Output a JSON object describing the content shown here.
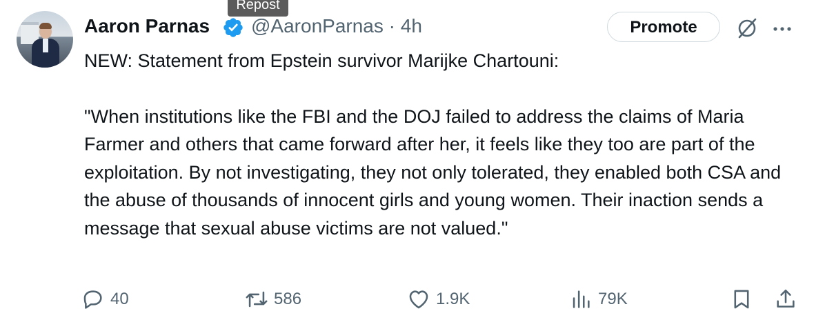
{
  "tooltip": {
    "text": "Repost"
  },
  "author": {
    "name": "Aaron Parnas",
    "handle": "@AaronParnas",
    "time": "4h",
    "verified_color": "#1d9bf0"
  },
  "header": {
    "promote_label": "Promote",
    "icons": [
      "grok-icon",
      "more-options-icon"
    ]
  },
  "post": {
    "intro": "NEW: Statement from Epstein survivor Marijke Chartouni:",
    "quote": "\"When institutions like the FBI and the DOJ  failed to address the claims of Maria Farmer and others that came forward after her, it feels like they too are part of the exploitation. By not investigating, they not only tolerated, they enabled both CSA and the abuse of thousands of innocent girls and young women. Their inaction sends a message that sexual abuse victims are not valued.\""
  },
  "actions": {
    "replies": "40",
    "reposts": "586",
    "likes": "1.9K",
    "views": "79K",
    "icons": [
      "reply-icon",
      "repost-icon",
      "like-icon",
      "views-icon",
      "bookmark-icon",
      "share-icon"
    ]
  },
  "colors": {
    "text": "#0f1419",
    "muted": "#536471",
    "border": "#cfd9de"
  }
}
